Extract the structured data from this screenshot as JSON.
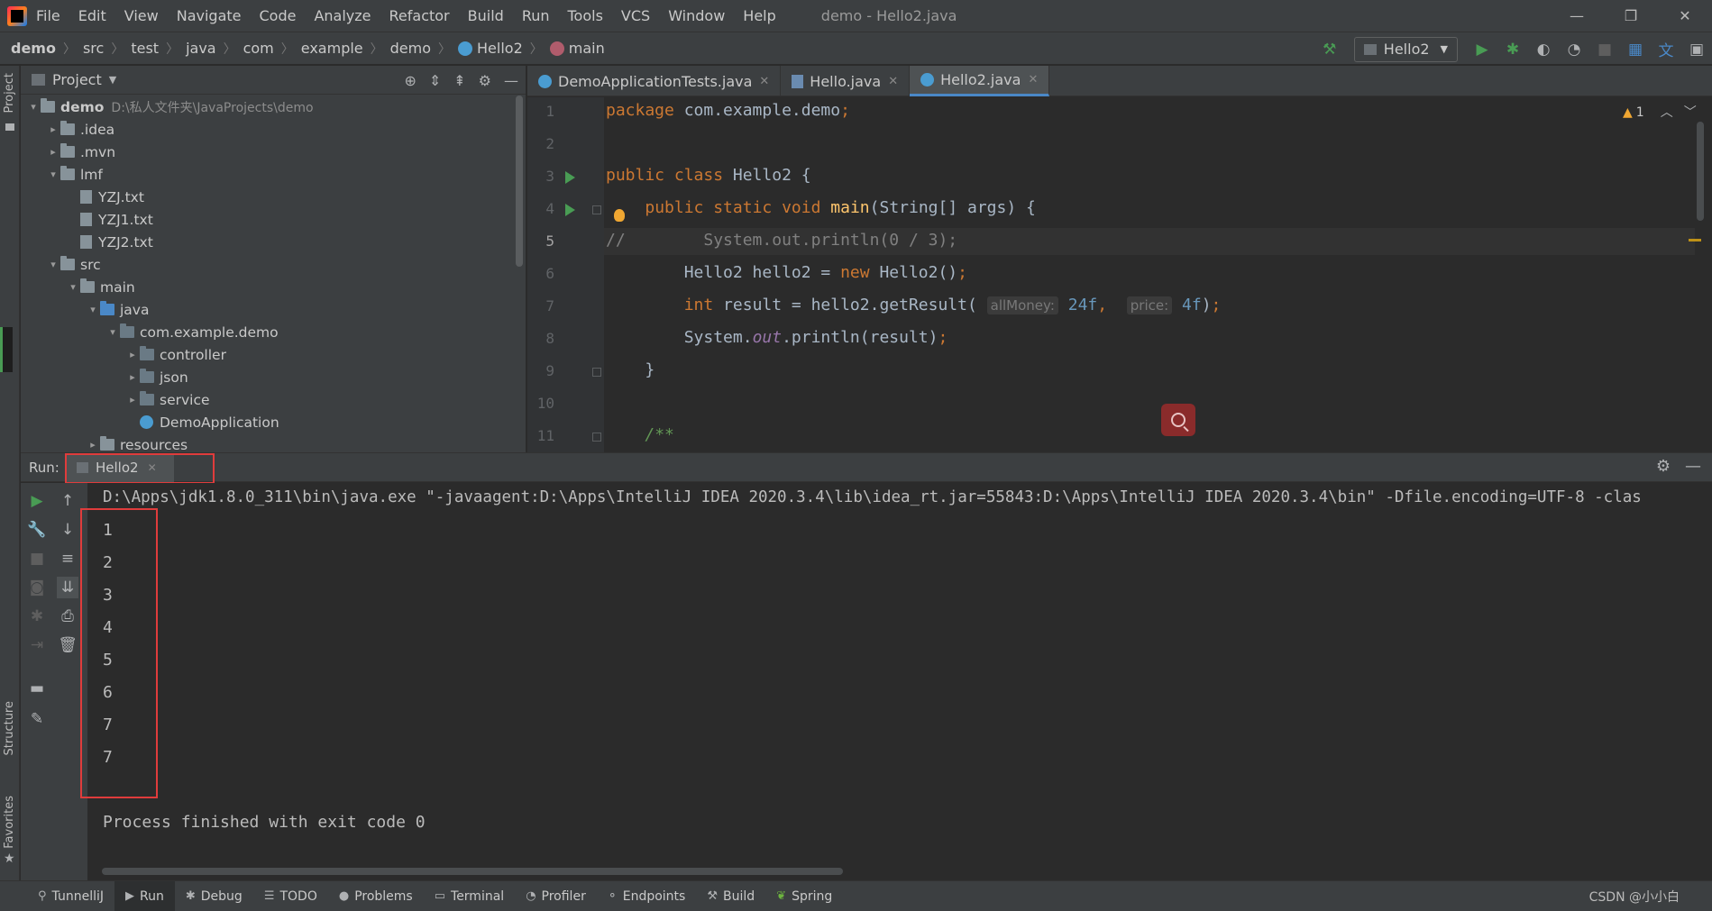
{
  "menu": {
    "items": [
      "File",
      "Edit",
      "View",
      "Navigate",
      "Code",
      "Analyze",
      "Refactor",
      "Build",
      "Run",
      "Tools",
      "VCS",
      "Window",
      "Help"
    ],
    "window_title": "demo - Hello2.java",
    "win_buttons": [
      "—",
      "❐",
      "✕"
    ]
  },
  "breadcrumb": [
    "demo",
    "src",
    "test",
    "java",
    "com",
    "example",
    "demo",
    "Hello2",
    "main"
  ],
  "run_config": "Hello2",
  "side_labels": {
    "project": "Project",
    "structure": "Structure",
    "favorites": "Favorites"
  },
  "project": {
    "title": "Project",
    "tree": [
      {
        "label": "demo",
        "path": "D:\\私人文件夹\\JavaProjects\\demo",
        "type": "module",
        "arrow": "▾"
      },
      {
        "label": ".idea",
        "type": "folder",
        "arrow": "▸"
      },
      {
        "label": ".mvn",
        "type": "folder",
        "arrow": "▸"
      },
      {
        "label": "lmf",
        "type": "folder",
        "arrow": "▾"
      },
      {
        "label": "YZJ.txt",
        "type": "file",
        "arrow": ""
      },
      {
        "label": "YZJ1.txt",
        "type": "file",
        "arrow": ""
      },
      {
        "label": "YZJ2.txt",
        "type": "file",
        "arrow": ""
      },
      {
        "label": "src",
        "type": "folder",
        "arrow": "▾"
      },
      {
        "label": "main",
        "type": "folder",
        "arrow": "▾"
      },
      {
        "label": "java",
        "type": "folder-blue",
        "arrow": "▾"
      },
      {
        "label": "com.example.demo",
        "type": "package",
        "arrow": "▾"
      },
      {
        "label": "controller",
        "type": "package",
        "arrow": "▸"
      },
      {
        "label": "json",
        "type": "package",
        "arrow": "▸"
      },
      {
        "label": "service",
        "type": "package",
        "arrow": "▸"
      },
      {
        "label": "DemoApplication",
        "type": "class",
        "arrow": ""
      },
      {
        "label": "resources",
        "type": "folder",
        "arrow": "▸"
      }
    ]
  },
  "editor": {
    "tabs": [
      {
        "label": "DemoApplicationTests.java",
        "active": false
      },
      {
        "label": "Hello.java",
        "active": false
      },
      {
        "label": "Hello2.java",
        "active": true
      }
    ],
    "warning_count": "1",
    "line_numbers": [
      "1",
      "2",
      "3",
      "4",
      "5",
      "6",
      "7",
      "8",
      "9",
      "10",
      "11"
    ],
    "current_line": "5"
  },
  "run": {
    "label": "Run:",
    "tab": "Hello2",
    "command": "D:\\Apps\\jdk1.8.0_311\\bin\\java.exe \"-javaagent:D:\\Apps\\IntelliJ IDEA 2020.3.4\\lib\\idea_rt.jar=55843:D:\\Apps\\IntelliJ IDEA 2020.3.4\\bin\" -Dfile.encoding=UTF-8 -clas",
    "output": [
      "1",
      "2",
      "3",
      "4",
      "5",
      "6",
      "7",
      "7"
    ],
    "finished": "Process finished with exit code 0"
  },
  "bottom_tabs": [
    {
      "label": "TunnelliJ",
      "icon": "tunnel-icon"
    },
    {
      "label": "Run",
      "icon": "run-icon",
      "active": true
    },
    {
      "label": "Debug",
      "icon": "bug-icon"
    },
    {
      "label": "TODO",
      "icon": "list-icon"
    },
    {
      "label": "Problems",
      "icon": "info-icon"
    },
    {
      "label": "Terminal",
      "icon": "terminal-icon"
    },
    {
      "label": "Profiler",
      "icon": "profiler-icon"
    },
    {
      "label": "Endpoints",
      "icon": "endpoints-icon"
    },
    {
      "label": "Build",
      "icon": "hammer-icon"
    },
    {
      "label": "Spring",
      "icon": "spring-icon"
    }
  ],
  "watermark": "CSDN @小小白"
}
